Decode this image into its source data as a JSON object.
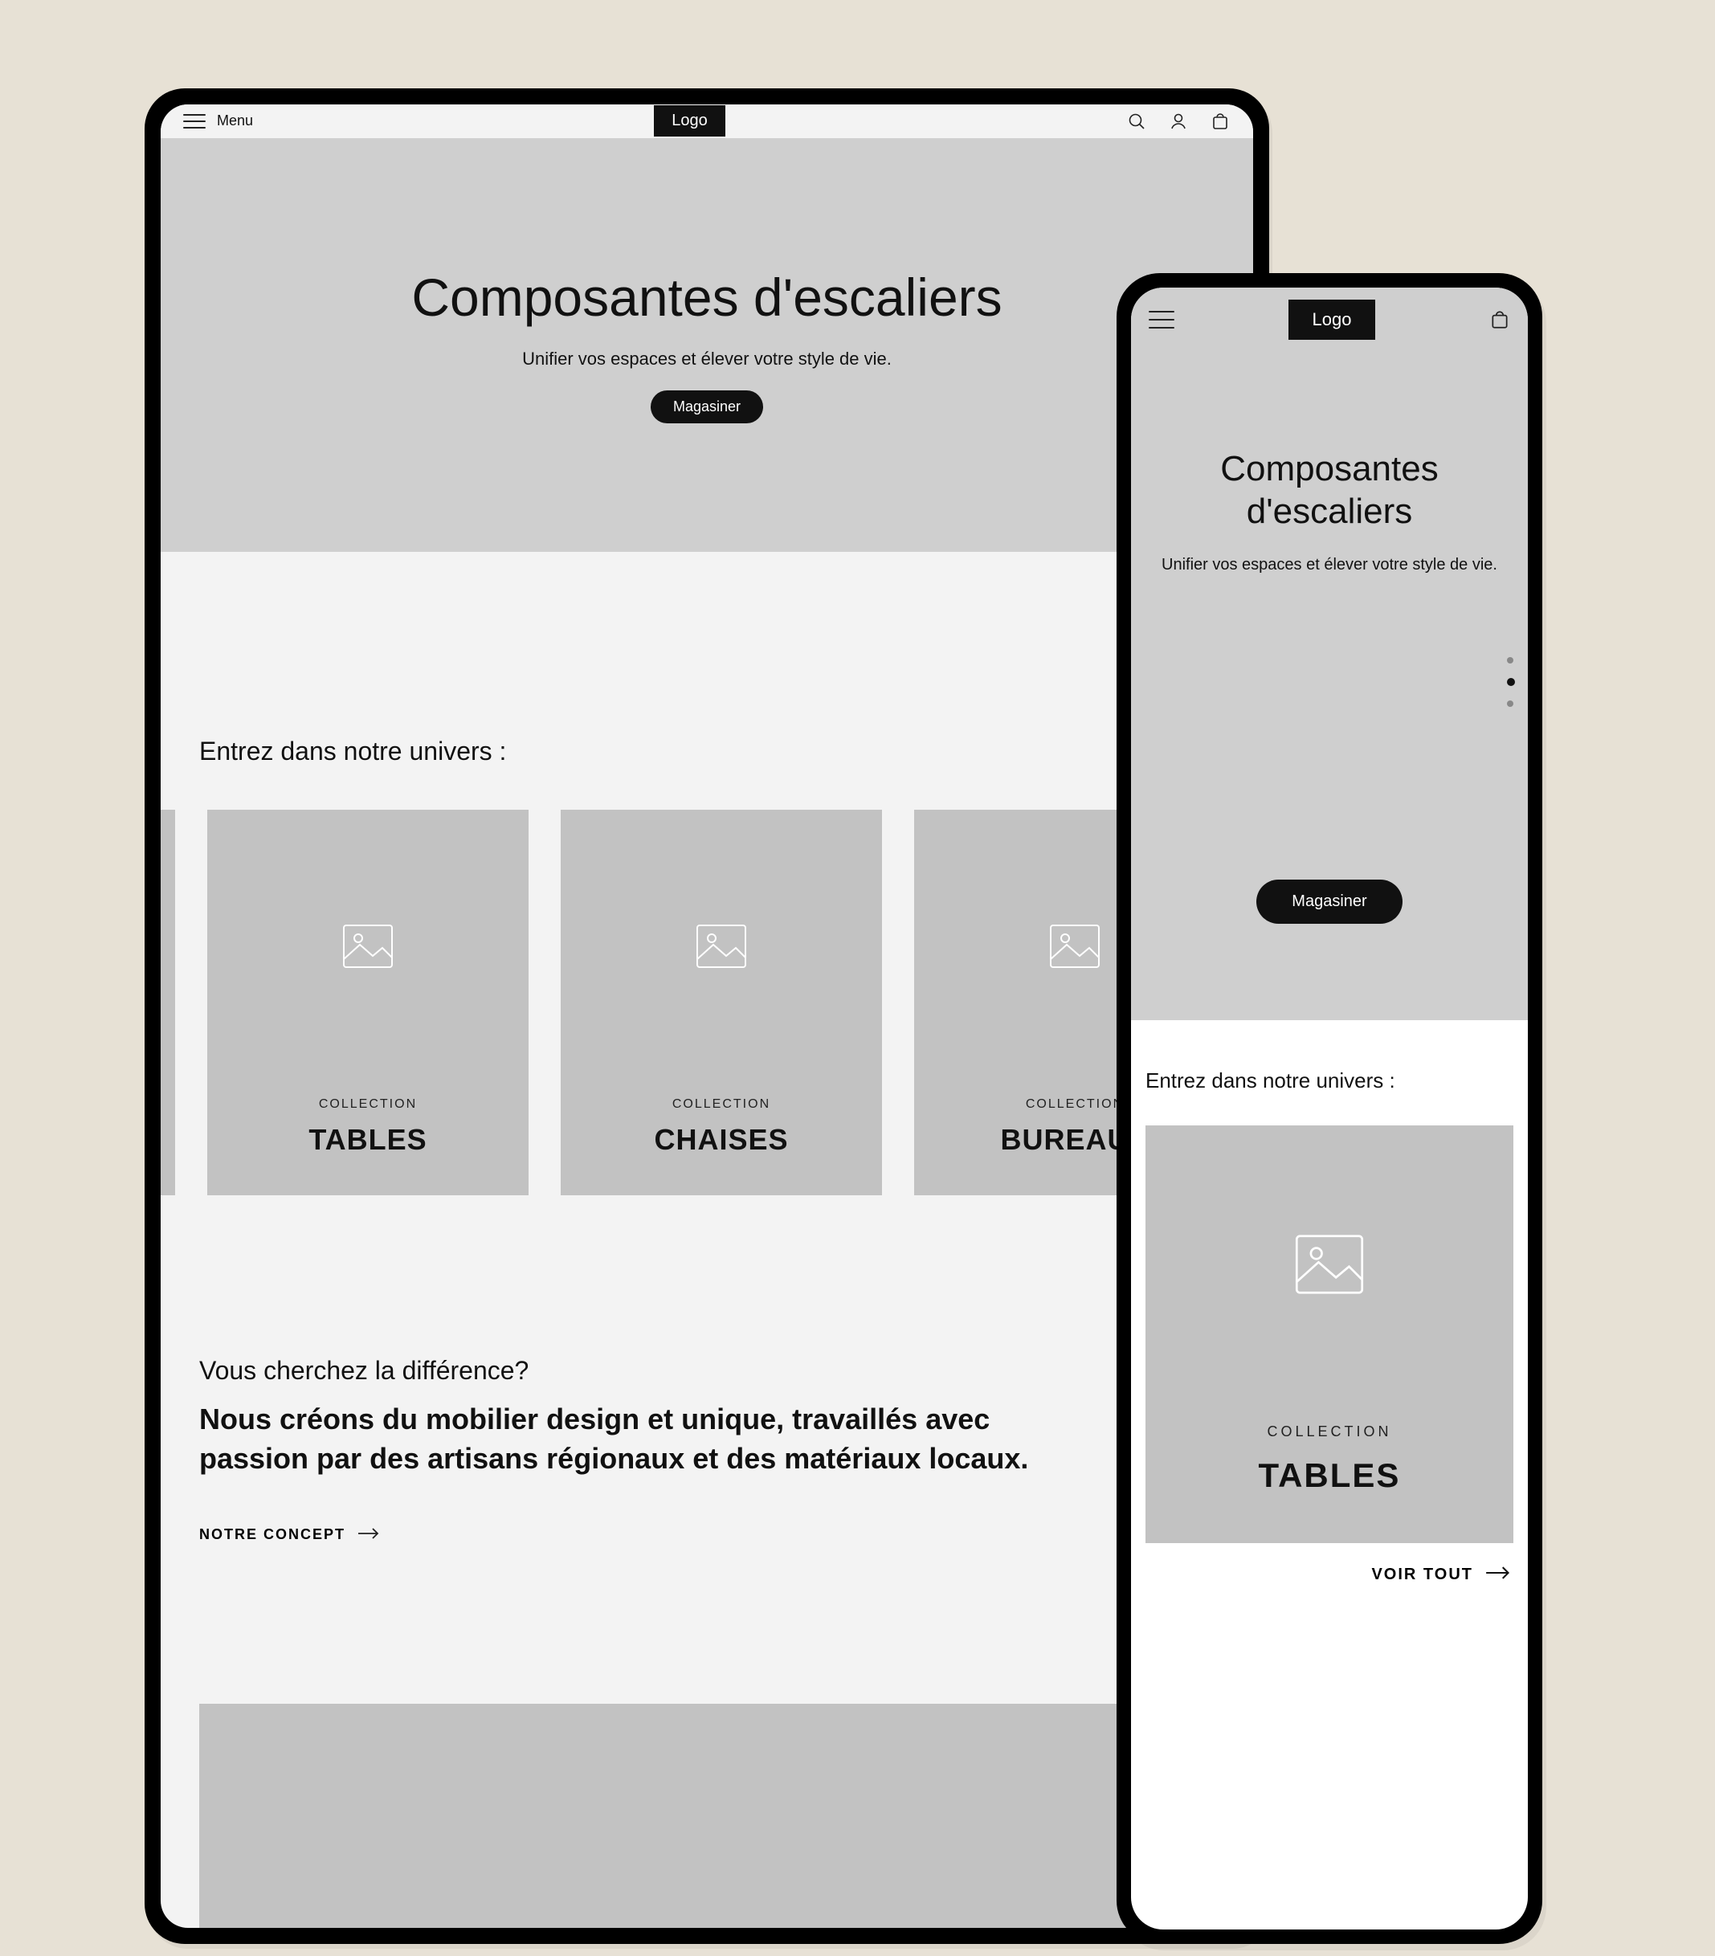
{
  "header": {
    "menu_label": "Menu",
    "logo_text": "Logo"
  },
  "hero": {
    "title": "Composantes d'escaliers",
    "subtitle": "Unifier vos espaces et élever votre style de vie.",
    "cta_label": "Magasiner"
  },
  "universe": {
    "heading": "Entrez dans notre univers :",
    "overline": "COLLECTION",
    "cards": [
      {
        "name": "TABLES"
      },
      {
        "name": "CHAISES"
      },
      {
        "name": "BUREAUX"
      }
    ],
    "voir_tout": "VOIR TOUT"
  },
  "difference": {
    "question": "Vous cherchez la différence?",
    "statement": "Nous créons du mobilier design et unique,  travaillés avec passion par des artisans régionaux et des matériaux locaux.",
    "concept_label": "NOTRE CONCEPT"
  },
  "icons": {
    "hamburger": "hamburger-icon",
    "search": "search-icon",
    "user": "user-icon",
    "bag": "bag-icon",
    "image_placeholder": "image-placeholder-icon",
    "arrow_right": "arrow-right-icon"
  }
}
